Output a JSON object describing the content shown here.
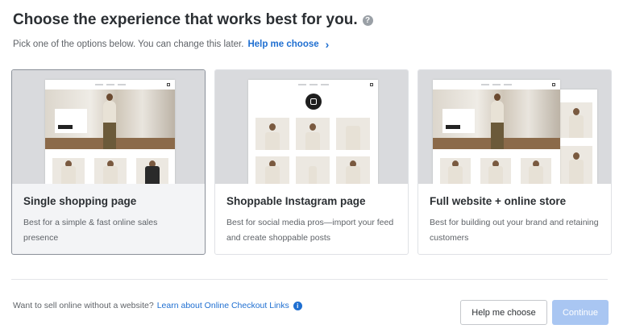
{
  "header": {
    "title": "Choose the experience that works best for you.",
    "help_icon": "question-circle-icon",
    "subtitle": "Pick one of the options below. You can change this later.",
    "help_link": "Help me choose",
    "help_link_icon": "chevron-right-icon"
  },
  "cards": [
    {
      "title": "Single shopping page",
      "description": "Best for a simple & fast online sales presence",
      "selected": true
    },
    {
      "title": "Shoppable Instagram page",
      "description": "Best for social media pros—import your feed and create shoppable posts",
      "selected": false
    },
    {
      "title": "Full website + online store",
      "description": "Best for building out your brand and retaining customers",
      "selected": false
    }
  ],
  "footer": {
    "question": "Want to sell online without a website?",
    "link": "Learn about Online Checkout Links",
    "info_icon": "info-circle-icon",
    "help_button": "Help me choose",
    "continue_button": "Continue"
  },
  "colors": {
    "accent": "#1f6fd1",
    "continue_disabled": "#a9c6f2",
    "selected_card_bg": "#f3f4f6"
  }
}
